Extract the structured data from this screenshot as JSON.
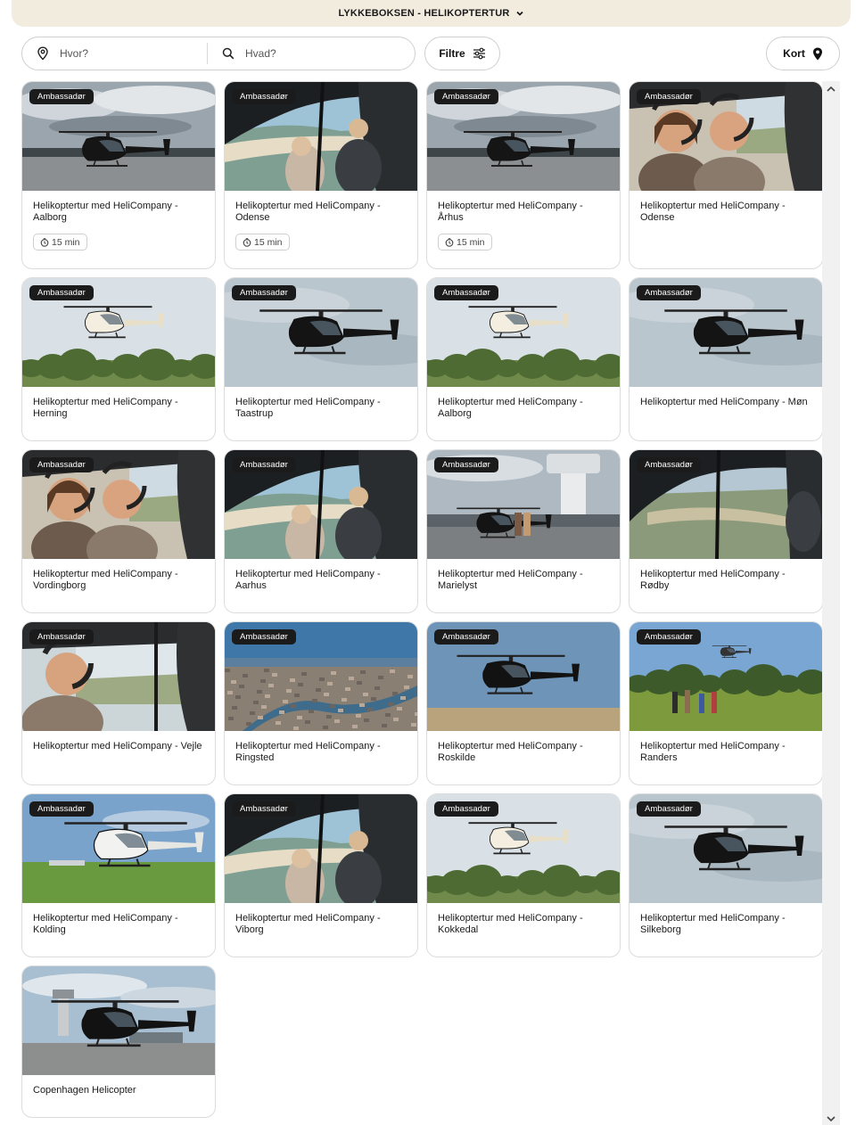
{
  "header": {
    "title": "LYKKEBOKSEN - HELIKOPTERTUR",
    "chevron_icon": "chevron-down-icon"
  },
  "search": {
    "where_placeholder": "Hvor?",
    "what_placeholder": "Hvad?",
    "where_icon": "location-pin-icon",
    "what_icon": "search-icon"
  },
  "filter_button": {
    "label": "Filtre",
    "icon": "sliders-icon"
  },
  "map_button": {
    "label": "Kort",
    "icon": "map-pin-icon"
  },
  "badge_label": "Ambassadør",
  "cards": [
    {
      "title": "Helikoptertur med HeliCompany - Aalborg",
      "badge": "Ambassadør",
      "duration": "15 min",
      "scene": "black-ground"
    },
    {
      "title": "Helikoptertur med HeliCompany - Odense",
      "badge": "Ambassadør",
      "duration": "15 min",
      "scene": "cockpit-coast"
    },
    {
      "title": "Helikoptertur med HeliCompany - Århus",
      "badge": "Ambassadør",
      "duration": "15 min",
      "scene": "black-ground"
    },
    {
      "title": "Helikoptertur med HeliCompany - Odense",
      "badge": "Ambassadør",
      "duration": "",
      "scene": "selfie"
    },
    {
      "title": "Helikoptertur med HeliCompany - Herning",
      "badge": "Ambassadør",
      "duration": "",
      "scene": "white-flying"
    },
    {
      "title": "Helikoptertur med HeliCompany - Taastrup",
      "badge": "Ambassadør",
      "duration": "",
      "scene": "black-flying"
    },
    {
      "title": "Helikoptertur med HeliCompany - Aalborg",
      "badge": "Ambassadør",
      "duration": "",
      "scene": "white-flying"
    },
    {
      "title": "Helikoptertur med HeliCompany - Møn",
      "badge": "Ambassadør",
      "duration": "",
      "scene": "black-flying"
    },
    {
      "title": "Helikoptertur med HeliCompany - Vordingborg",
      "badge": "Ambassadør",
      "duration": "",
      "scene": "selfie"
    },
    {
      "title": "Helikoptertur med HeliCompany - Aarhus",
      "badge": "Ambassadør",
      "duration": "",
      "scene": "cockpit-coast"
    },
    {
      "title": "Helikoptertur med HeliCompany - Marielyst",
      "badge": "Ambassadør",
      "duration": "",
      "scene": "tower"
    },
    {
      "title": "Helikoptertur med HeliCompany - Rødby",
      "badge": "Ambassadør",
      "duration": "",
      "scene": "cockpit-land"
    },
    {
      "title": "Helikoptertur med HeliCompany - Vejle",
      "badge": "Ambassadør",
      "duration": "",
      "scene": "pilot"
    },
    {
      "title": "Helikoptertur med HeliCompany - Ringsted",
      "badge": "Ambassadør",
      "duration": "",
      "scene": "city"
    },
    {
      "title": "Helikoptertur med HeliCompany - Roskilde",
      "badge": "Ambassadør",
      "duration": "",
      "scene": "black-sky"
    },
    {
      "title": "Helikoptertur med HeliCompany - Randers",
      "badge": "Ambassadør",
      "duration": "",
      "scene": "field"
    },
    {
      "title": "Helikoptertur med HeliCompany - Kolding",
      "badge": "Ambassadør",
      "duration": "",
      "scene": "white-grass"
    },
    {
      "title": "Helikoptertur med HeliCompany - Viborg",
      "badge": "Ambassadør",
      "duration": "",
      "scene": "cockpit-coast"
    },
    {
      "title": "Helikoptertur med HeliCompany - Kokkedal",
      "badge": "Ambassadør",
      "duration": "",
      "scene": "white-flying"
    },
    {
      "title": "Helikoptertur med HeliCompany - Silkeborg",
      "badge": "Ambassadør",
      "duration": "",
      "scene": "black-flying"
    },
    {
      "title": "Copenhagen Helicopter",
      "badge": "",
      "duration": "",
      "scene": "black-airport"
    }
  ]
}
